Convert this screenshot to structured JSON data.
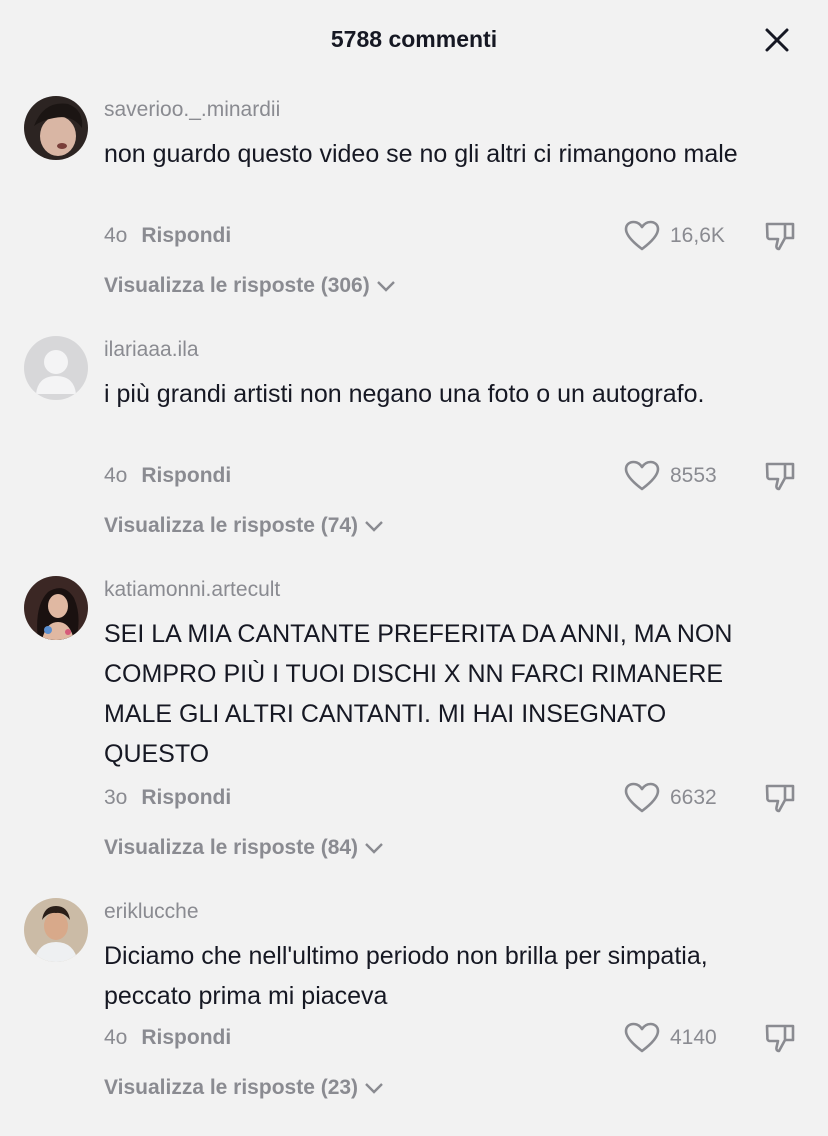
{
  "header": {
    "title": "5788 commenti"
  },
  "comments": [
    {
      "username": "saverioo._.minardii",
      "text": "non guardo questo video se no gli altri ci rimangono male",
      "age": "4o",
      "reply_label": "Rispondi",
      "likes": "16,6K",
      "replies_label": "Visualizza le risposte (306)",
      "avatar_color": "#3a2e2a"
    },
    {
      "username": "ilariaaa.ila",
      "text": "i più grandi artisti non negano una foto o un autografo.",
      "age": "4o",
      "reply_label": "Rispondi",
      "likes": "8553",
      "replies_label": "Visualizza le risposte (74)",
      "avatar_color": "#d7d7d9"
    },
    {
      "username": "katiamonni.artecult",
      "text": "SEI LA MIA CANTANTE PREFERITA DA ANNI, MA NON COMPRO PIÙ I TUOI DISCHI X NN FARCI RIMANERE MALE GLI ALTRI CANTANTI. MI HAI INSEGNATO QUESTO",
      "age": "3o",
      "reply_label": "Rispondi",
      "likes": "6632",
      "replies_label": "Visualizza le risposte (84)",
      "avatar_color": "#4a2d2a"
    },
    {
      "username": "eriklucche",
      "text": "Diciamo che nell'ultimo periodo non brilla per simpatia, peccato prima mi piaceva",
      "age": "4o",
      "reply_label": "Rispondi",
      "likes": "4140",
      "replies_label": "Visualizza le risposte (23)",
      "avatar_color": "#b9a48c"
    }
  ],
  "icons": {
    "close": "close-icon",
    "like": "heart-outline-icon",
    "dislike": "thumbs-down-icon",
    "expand": "chevron-down-icon"
  }
}
